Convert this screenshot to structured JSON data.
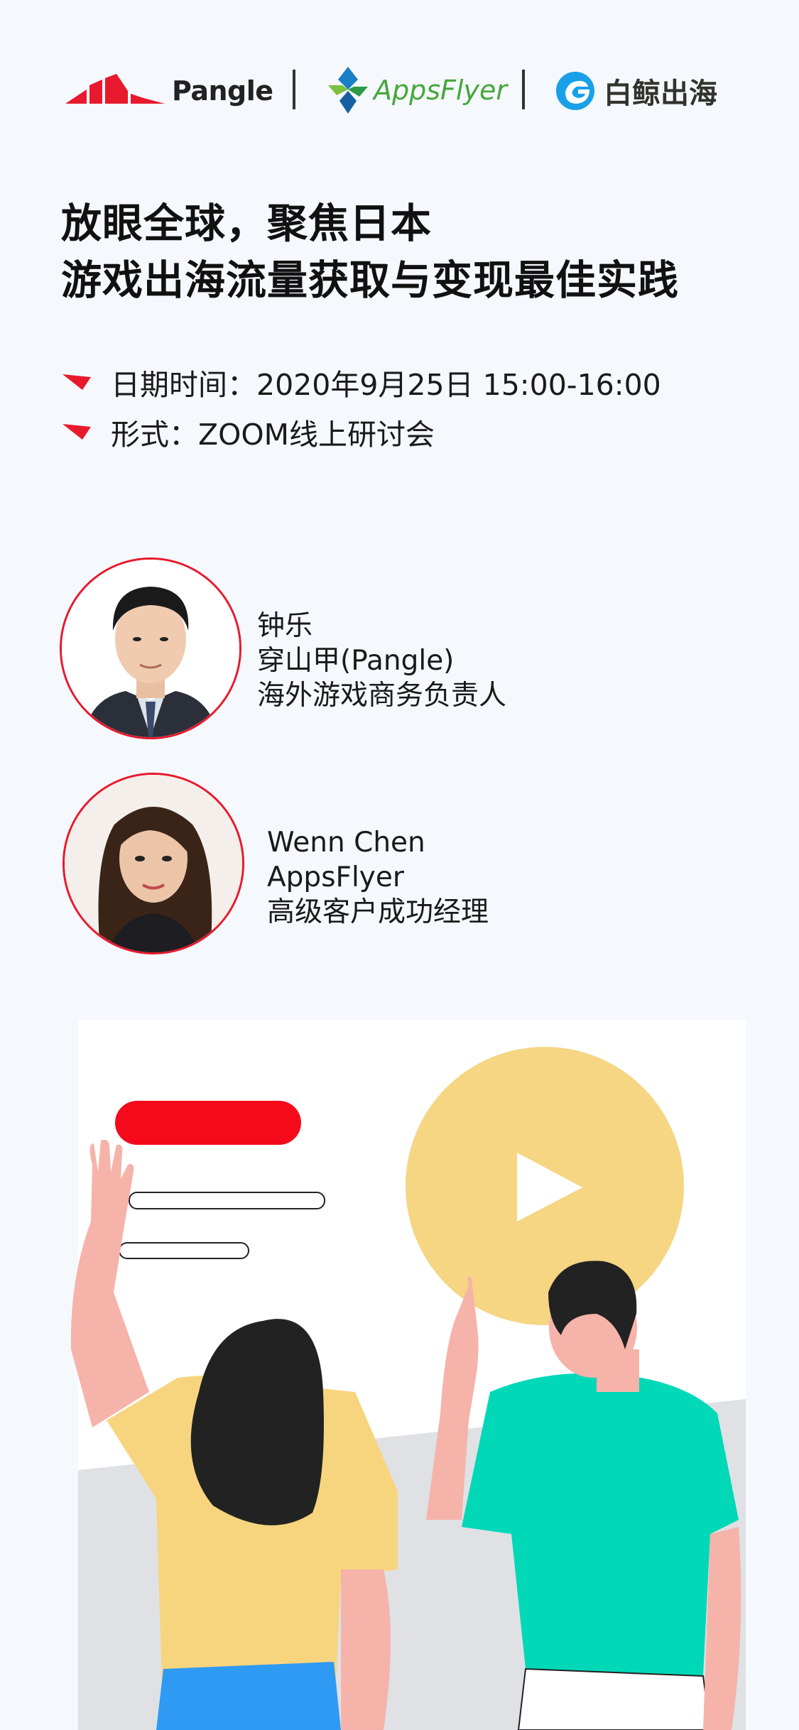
{
  "logos": {
    "pangle": {
      "text": "Pangle",
      "color": "#e8192c"
    },
    "appsflyer": {
      "text": "AppsFlyer",
      "color": "#46a73b"
    },
    "baijing": {
      "text": "白鲸出海",
      "color": "#1aa0e8"
    }
  },
  "title": {
    "line1": "放眼全球，聚焦日本",
    "line2": "游戏出海流量获取与变现最佳实践"
  },
  "info": {
    "date": "日期时间：2020年9月25日 15:00-16:00",
    "format": "形式：ZOOM线上研讨会"
  },
  "speakers": [
    {
      "name": "钟乐",
      "company": "穿山甲(Pangle)",
      "role": "海外游戏商务负责人"
    },
    {
      "name": "Wenn Chen",
      "company": "AppsFlyer",
      "role": "高级客户成功经理"
    }
  ],
  "colors": {
    "accent": "#e8192c",
    "background": "#f5f8fc",
    "circle": "#f6d583",
    "shirt_green": "#00d8b8",
    "shirt_yellow": "#f7d57e"
  }
}
